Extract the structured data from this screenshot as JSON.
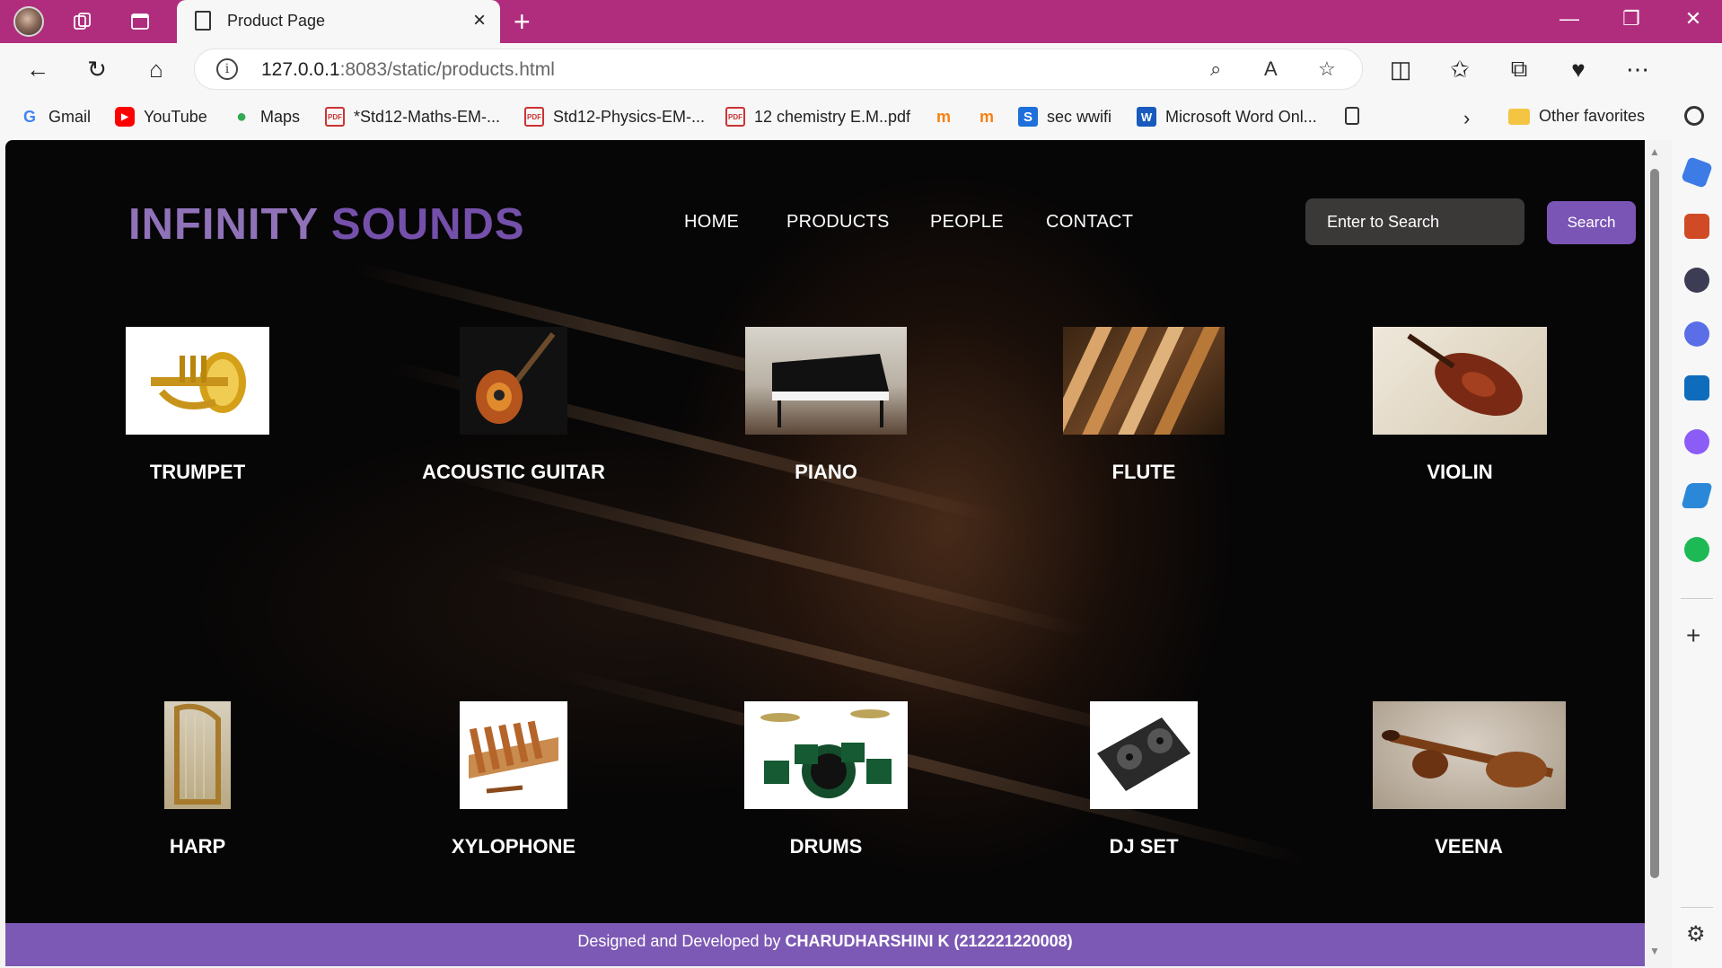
{
  "browser": {
    "tab_title": "Product Page",
    "new_tab_icon": "plus-icon",
    "url_host": "127.0.0.1",
    "url_rest": ":8083/static/products.html",
    "favorites": [
      {
        "label": "Gmail",
        "icon": "google-icon"
      },
      {
        "label": "YouTube",
        "icon": "youtube-icon"
      },
      {
        "label": "Maps",
        "icon": "maps-pin-icon"
      },
      {
        "label": "*Std12-Maths-EM-...",
        "icon": "pdf-icon"
      },
      {
        "label": "Std12-Physics-EM-...",
        "icon": "pdf-icon"
      },
      {
        "label": "12 chemistry E.M..pdf",
        "icon": "pdf-icon"
      },
      {
        "label": "sec wwifi",
        "icon": "s-app-icon"
      },
      {
        "label": "Microsoft Word Onl...",
        "icon": "word-icon"
      }
    ],
    "other_favorites": "Other favorites"
  },
  "site": {
    "logo_part1": "INFINITY",
    "logo_part2": "SOUNDS",
    "menu": [
      "HOME",
      "PRODUCTS",
      "PEOPLE",
      "CONTACT"
    ],
    "search_placeholder": "Enter to Search",
    "search_button": "Search"
  },
  "products": [
    {
      "name": "TRUMPET"
    },
    {
      "name": "ACOUSTIC GUITAR"
    },
    {
      "name": "PIANO"
    },
    {
      "name": "FLUTE"
    },
    {
      "name": "VIOLIN"
    },
    {
      "name": "HARP"
    },
    {
      "name": "XYLOPHONE"
    },
    {
      "name": "DRUMS"
    },
    {
      "name": "DJ SET"
    },
    {
      "name": "VEENA"
    }
  ],
  "footer": {
    "prefix": "Designed and Developed by",
    "author": "CHARUDHARSHINI K (212221220008)"
  },
  "colors": {
    "titlebar": "#b02d7d",
    "accent_purple": "#7b55b6",
    "logo_light": "#8f72b8",
    "logo_dark": "#7450aa"
  }
}
